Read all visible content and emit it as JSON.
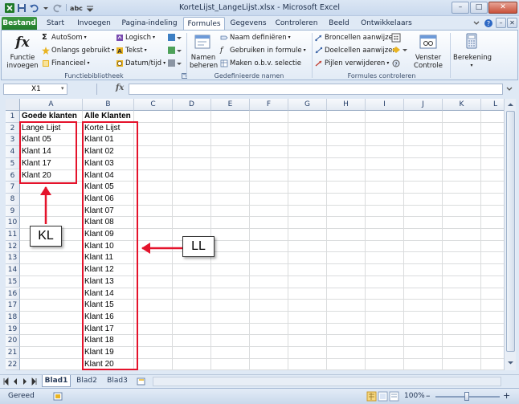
{
  "window": {
    "title": "KorteLijst_LangeLijst.xlsx - Microsoft Excel",
    "minimize": "–",
    "maximize": "□",
    "close": "✕"
  },
  "qat": {
    "undo_sep": "|",
    "abc": "abc"
  },
  "tabs": [
    "Bestand",
    "Start",
    "Invoegen",
    "Pagina-indeling",
    "Formules",
    "Gegevens",
    "Controleren",
    "Beeld",
    "Ontwikkelaars"
  ],
  "ribbon": {
    "functielib": {
      "insert_function": "Functie invoegen",
      "autosom": "AutoSom",
      "recent": "Onlangs gebruikt",
      "financial": "Financieel",
      "logical": "Logisch",
      "text": "Tekst",
      "datetime": "Datum/tijd",
      "label": "Functiebibliotheek"
    },
    "names": {
      "manager": "Namen beheren",
      "define": "Naam definiëren",
      "use_in_formula": "Gebruiken in formule",
      "create_from_selection": "Maken o.b.v. selectie",
      "label": "Gedefinieerde namen"
    },
    "audit": {
      "trace_precedents": "Broncellen aanwijzen",
      "trace_dependents": "Doelcellen aanwijzen",
      "remove_arrows": "Pijlen verwijderen",
      "watch_window": "Venster Controle",
      "label": "Formules controleren"
    },
    "calc": {
      "calculation": "Berekening"
    }
  },
  "formula_bar": {
    "name_box": "X1",
    "fx": "fx",
    "value": ""
  },
  "columns": [
    "A",
    "B",
    "C",
    "D",
    "E",
    "F",
    "G",
    "H",
    "I",
    "J",
    "K",
    "L"
  ],
  "rows": [
    "1",
    "2",
    "3",
    "4",
    "5",
    "6",
    "7",
    "8",
    "9",
    "10",
    "11",
    "12",
    "13",
    "14",
    "15",
    "16",
    "17",
    "18",
    "19",
    "20",
    "21",
    "22"
  ],
  "cells": {
    "colA": [
      "Goede klanten",
      "Lange Lijst",
      "Klant 05",
      "Klant 14",
      "Klant 17",
      "Klant 20"
    ],
    "colB": [
      "Alle Klanten",
      "Korte Lijst",
      "Klant 01",
      "Klant 02",
      "Klant 03",
      "Klant 04",
      "Klant 05",
      "Klant 06",
      "Klant 07",
      "Klant 08",
      "Klant 09",
      "Klant 10",
      "Klant 11",
      "Klant 12",
      "Klant 13",
      "Klant 14",
      "Klant 15",
      "Klant 16",
      "Klant 17",
      "Klant 18",
      "Klant 19",
      "Klant 20"
    ]
  },
  "annotations": {
    "kl": "KL",
    "ll": "LL",
    "accent": "#e4132b"
  },
  "sheets": [
    "Blad1",
    "Blad2",
    "Blad3"
  ],
  "status": {
    "mode": "Gereed",
    "zoom": "100%",
    "minus": "–",
    "plus": "+"
  }
}
